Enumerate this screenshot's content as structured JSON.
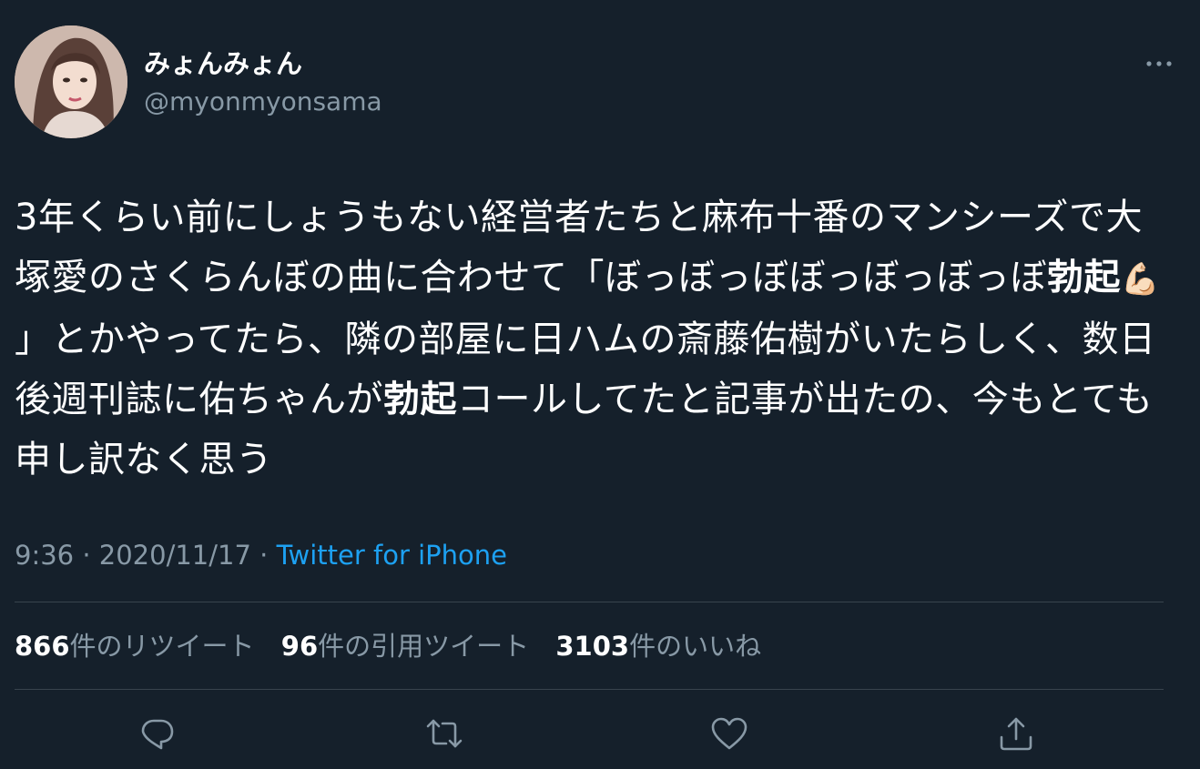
{
  "user": {
    "display_name": "みょんみょん",
    "handle": "@myonmyonsama"
  },
  "tweet": {
    "text_part1": "3年くらい前にしょうもない経営者たちと麻布十番のマンシーズで大塚愛のさくらんぼの曲に合わせて「ぼっぼっぼぼっぼっぼっぼ",
    "bold1": "勃起",
    "emoji": "💪🏻",
    "text_part2": "」とかやってたら、隣の部屋に日ハムの斎藤佑樹がいたらしく、数日後週刊誌に佑ちゃんが",
    "bold2": "勃起",
    "text_part3": "コールしてたと記事が出たの、今もとても申し訳なく思う"
  },
  "meta": {
    "time": "9:36",
    "date": "2020/11/17",
    "separator": "·",
    "source": "Twitter for iPhone"
  },
  "stats": {
    "retweets_num": "866",
    "retweets_label": "件のリツイート",
    "quotes_num": "96",
    "quotes_label": "件の引用ツイート",
    "likes_num": "3103",
    "likes_label": "件のいいね"
  },
  "icons": {
    "more": "more-horizontal-icon",
    "reply": "reply-icon",
    "retweet": "retweet-icon",
    "like": "heart-icon",
    "share": "share-icon"
  },
  "colors": {
    "background": "#15202b",
    "secondary_text": "#8899a6",
    "accent": "#1da1f2",
    "divider": "#38444d"
  }
}
